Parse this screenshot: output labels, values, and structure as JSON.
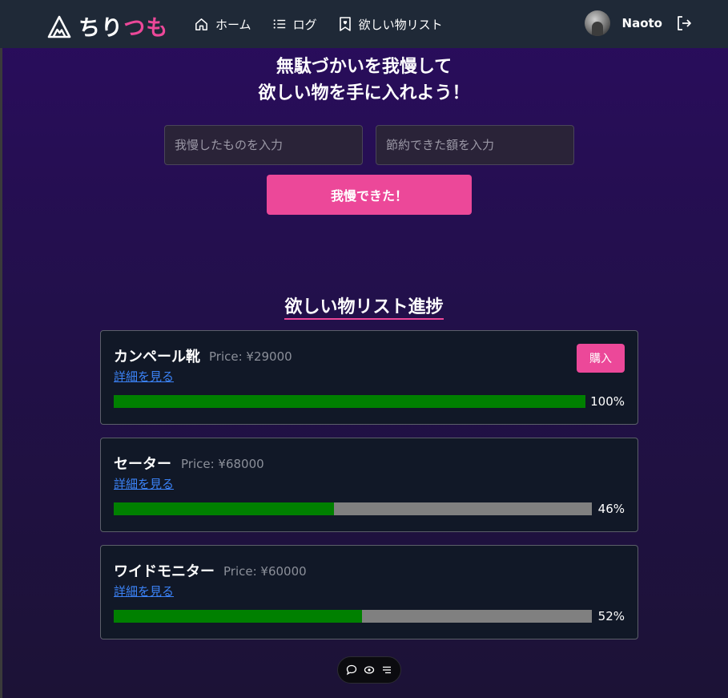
{
  "header": {
    "logo_chiri": "ちり",
    "logo_tsumo": "つも",
    "nav": [
      {
        "label": "ホーム",
        "icon": "home-icon"
      },
      {
        "label": "ログ",
        "icon": "list-icon"
      },
      {
        "label": "欲しい物リスト",
        "icon": "bookmark-heart-icon"
      }
    ],
    "user_name": "Naoto"
  },
  "hero": {
    "title_line1": "無駄づかいを我慢して",
    "title_line2": "欲しい物を手に入れよう！",
    "item_placeholder": "我慢したものを入力",
    "amount_placeholder": "節約できた額を入力",
    "submit_label": "我慢できた！"
  },
  "wishlist": {
    "title": "欲しい物リスト進捗",
    "items": [
      {
        "name": "カンペール靴",
        "price": "Price: ¥29000",
        "link": "詳細を見る",
        "progress": 1.0,
        "progress_label": "100%",
        "buy_label": "購入"
      },
      {
        "name": "セーター",
        "price": "Price: ¥68000",
        "link": "詳細を見る",
        "progress": 0.46,
        "progress_label": "46%"
      },
      {
        "name": "ワイドモニター",
        "price": "Price: ¥60000",
        "link": "詳細を見る",
        "progress": 0.52,
        "progress_label": "52%"
      }
    ]
  },
  "colors": {
    "accent": "#ec4899",
    "header_bg": "#1f2937",
    "card_bg": "#111827",
    "progress_fill": "#008000",
    "progress_track": "#808080",
    "link": "#3b82f6"
  },
  "floating_toolbar": {
    "icons": [
      "chat-bubble-icon",
      "eye-icon",
      "menu-lines-icon"
    ]
  }
}
